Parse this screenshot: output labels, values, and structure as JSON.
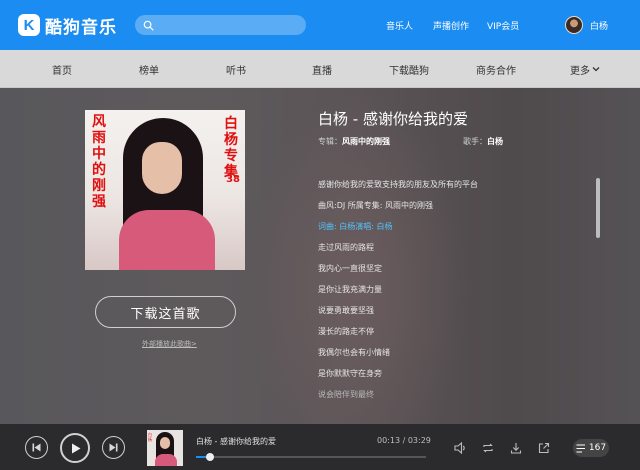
{
  "header": {
    "logo_mark": "K",
    "logo_text": "酷狗音乐",
    "search_placeholder": "",
    "nav": [
      "音乐人",
      "声播创作",
      "VIP会员"
    ],
    "user_name": "白杨"
  },
  "subnav": {
    "items": [
      "首页",
      "榜单",
      "听书",
      "直播",
      "下载酷狗",
      "商务合作",
      "更多"
    ]
  },
  "album": {
    "cover_text_left": "风雨中的刚强",
    "cover_text_right": "白杨专集",
    "cover_number": "38"
  },
  "download_button": "下载这首歌",
  "external_link": "外部播放此歌曲>",
  "song": {
    "title": "白杨 - 感谢你给我的爱",
    "album_label": "专辑：",
    "album_name": "风雨中的刚强",
    "singer_label": "歌手：",
    "singer_name": "白杨"
  },
  "lyrics": [
    "感谢你给我的爱致支持我的朋友及所有的平台",
    "曲风:DJ 所属专集: 风雨中的刚强",
    "词曲: 白杨演唱: 白杨",
    "走过风雨的路程",
    "我内心一直很坚定",
    "是你让我充满力量",
    "说要勇敢要坚强",
    "漫长的路走不停",
    "我偶尔也会有小情绪",
    "是你默默守在身旁",
    "说会陪伴到最终"
  ],
  "active_lyric_index": 2,
  "player": {
    "now_playing": "白杨 - 感谢你给我的爱",
    "current_time": "00:13",
    "total_time": "03:29",
    "progress_fraction": 0.062,
    "thumb_text": "白杨",
    "playlist_count": "167"
  },
  "colors": {
    "brand": "#1b8cf2",
    "active_lyric": "#4fc6ff"
  }
}
